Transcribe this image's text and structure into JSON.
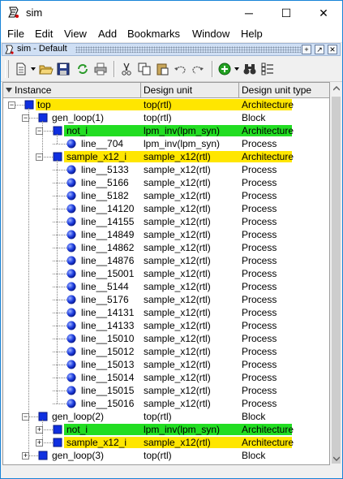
{
  "window": {
    "title": "sim",
    "minimize": "─",
    "maximize": "☐",
    "close": "✕"
  },
  "menu": [
    "File",
    "Edit",
    "View",
    "Add",
    "Bookmarks",
    "Window",
    "Help"
  ],
  "subwindow": {
    "title": "sim - Default",
    "buttons": [
      "+",
      "↗",
      "✕"
    ]
  },
  "columns": [
    "Instance",
    "Design unit",
    "Design unit type"
  ],
  "colors": {
    "yellow": "#ffe600",
    "green": "#22dd22",
    "blue": "#0f2fe0"
  },
  "rows": [
    {
      "name": "top",
      "unit": "top(rtl)",
      "type": "Architecture",
      "level": 0,
      "icon": "square-icon",
      "exp": "minus",
      "hl": "yellow"
    },
    {
      "name": "gen_loop(1)",
      "unit": "top(rtl)",
      "type": "Block",
      "level": 1,
      "icon": "square-icon",
      "exp": "minus",
      "hl": ""
    },
    {
      "name": "not_i",
      "unit": "lpm_inv(lpm_syn)",
      "type": "Architecture",
      "level": 2,
      "icon": "square-icon",
      "exp": "minus",
      "hl": "green"
    },
    {
      "name": "line__704",
      "unit": "lpm_inv(lpm_syn)",
      "type": "Process",
      "level": 3,
      "icon": "circle-icon",
      "exp": "",
      "hl": ""
    },
    {
      "name": "sample_x12_i",
      "unit": "sample_x12(rtl)",
      "type": "Architecture",
      "level": 2,
      "icon": "square-icon",
      "exp": "minus",
      "hl": "yellow"
    },
    {
      "name": "line__5133",
      "unit": "sample_x12(rtl)",
      "type": "Process",
      "level": 3,
      "icon": "circle-icon",
      "exp": "",
      "hl": ""
    },
    {
      "name": "line__5166",
      "unit": "sample_x12(rtl)",
      "type": "Process",
      "level": 3,
      "icon": "circle-icon",
      "exp": "",
      "hl": ""
    },
    {
      "name": "line__5182",
      "unit": "sample_x12(rtl)",
      "type": "Process",
      "level": 3,
      "icon": "circle-icon",
      "exp": "",
      "hl": ""
    },
    {
      "name": "line__14120",
      "unit": "sample_x12(rtl)",
      "type": "Process",
      "level": 3,
      "icon": "circle-icon",
      "exp": "",
      "hl": ""
    },
    {
      "name": "line__14155",
      "unit": "sample_x12(rtl)",
      "type": "Process",
      "level": 3,
      "icon": "circle-icon",
      "exp": "",
      "hl": ""
    },
    {
      "name": "line__14849",
      "unit": "sample_x12(rtl)",
      "type": "Process",
      "level": 3,
      "icon": "circle-icon",
      "exp": "",
      "hl": ""
    },
    {
      "name": "line__14862",
      "unit": "sample_x12(rtl)",
      "type": "Process",
      "level": 3,
      "icon": "circle-icon",
      "exp": "",
      "hl": ""
    },
    {
      "name": "line__14876",
      "unit": "sample_x12(rtl)",
      "type": "Process",
      "level": 3,
      "icon": "circle-icon",
      "exp": "",
      "hl": ""
    },
    {
      "name": "line__15001",
      "unit": "sample_x12(rtl)",
      "type": "Process",
      "level": 3,
      "icon": "circle-icon",
      "exp": "",
      "hl": ""
    },
    {
      "name": "line__5144",
      "unit": "sample_x12(rtl)",
      "type": "Process",
      "level": 3,
      "icon": "circle-icon",
      "exp": "",
      "hl": ""
    },
    {
      "name": "line__5176",
      "unit": "sample_x12(rtl)",
      "type": "Process",
      "level": 3,
      "icon": "circle-icon",
      "exp": "",
      "hl": ""
    },
    {
      "name": "line__14131",
      "unit": "sample_x12(rtl)",
      "type": "Process",
      "level": 3,
      "icon": "circle-icon",
      "exp": "",
      "hl": ""
    },
    {
      "name": "line__14133",
      "unit": "sample_x12(rtl)",
      "type": "Process",
      "level": 3,
      "icon": "circle-icon",
      "exp": "",
      "hl": ""
    },
    {
      "name": "line__15010",
      "unit": "sample_x12(rtl)",
      "type": "Process",
      "level": 3,
      "icon": "circle-icon",
      "exp": "",
      "hl": ""
    },
    {
      "name": "line__15012",
      "unit": "sample_x12(rtl)",
      "type": "Process",
      "level": 3,
      "icon": "circle-icon",
      "exp": "",
      "hl": ""
    },
    {
      "name": "line__15013",
      "unit": "sample_x12(rtl)",
      "type": "Process",
      "level": 3,
      "icon": "circle-icon",
      "exp": "",
      "hl": ""
    },
    {
      "name": "line__15014",
      "unit": "sample_x12(rtl)",
      "type": "Process",
      "level": 3,
      "icon": "circle-icon",
      "exp": "",
      "hl": ""
    },
    {
      "name": "line__15015",
      "unit": "sample_x12(rtl)",
      "type": "Process",
      "level": 3,
      "icon": "circle-icon",
      "exp": "",
      "hl": ""
    },
    {
      "name": "line__15016",
      "unit": "sample_x12(rtl)",
      "type": "Process",
      "level": 3,
      "icon": "circle-icon",
      "exp": "",
      "hl": ""
    },
    {
      "name": "gen_loop(2)",
      "unit": "top(rtl)",
      "type": "Block",
      "level": 1,
      "icon": "square-icon",
      "exp": "minus",
      "hl": ""
    },
    {
      "name": "not_i",
      "unit": "lpm_inv(lpm_syn)",
      "type": "Architecture",
      "level": 2,
      "icon": "square-icon",
      "exp": "plus",
      "hl": "green"
    },
    {
      "name": "sample_x12_i",
      "unit": "sample_x12(rtl)",
      "type": "Architecture",
      "level": 2,
      "icon": "square-icon",
      "exp": "plus",
      "hl": "yellow"
    },
    {
      "name": "gen_loop(3)",
      "unit": "top(rtl)",
      "type": "Block",
      "level": 1,
      "icon": "square-icon",
      "exp": "plus",
      "hl": ""
    }
  ]
}
